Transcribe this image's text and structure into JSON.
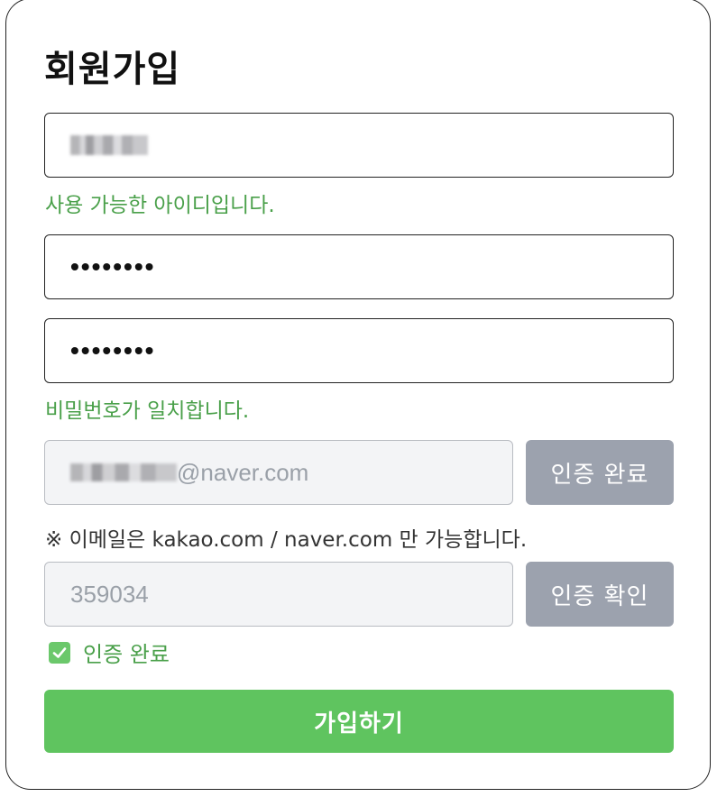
{
  "form": {
    "title": "회원가입",
    "username_msg": "사용 가능한 아이디입니다.",
    "password_value": "••••••••",
    "password_confirm_value": "••••••••",
    "password_msg": "비밀번호가 일치합니다.",
    "email_domain": "@naver.com",
    "email_button": "인증 완료",
    "email_note": "※ 이메일은 kakao.com / naver.com 만 가능합니다.",
    "code_value": "359034",
    "code_button": "인증 확인",
    "verified_label": "인증 완료",
    "submit_label": "가입하기"
  },
  "colors": {
    "success": "#4aa04a",
    "primary": "#5fc45f",
    "button_disabled": "#9ca2ae",
    "input_disabled_bg": "#f3f4f6"
  },
  "icons": {
    "verified": "checkbox-checked-icon"
  }
}
